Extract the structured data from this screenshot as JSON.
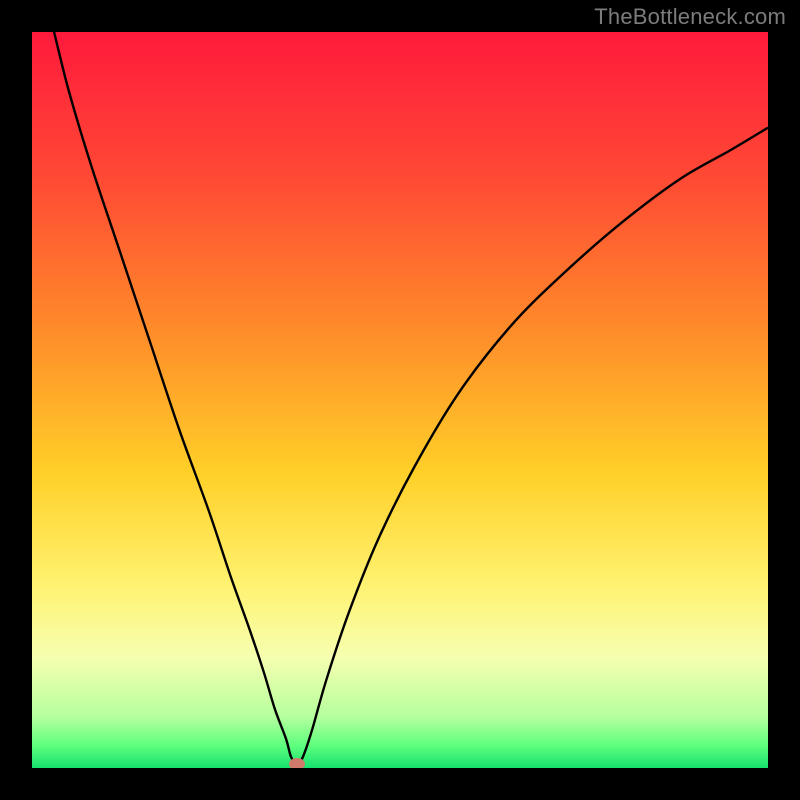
{
  "watermark": "TheBottleneck.com",
  "chart_data": {
    "type": "line",
    "title": "",
    "xlabel": "",
    "ylabel": "",
    "xlim": [
      0,
      100
    ],
    "ylim": [
      0,
      100
    ],
    "gradient_stops": [
      {
        "pos": 0,
        "color": "#ff1a3c"
      },
      {
        "pos": 20,
        "color": "#ff4a34"
      },
      {
        "pos": 40,
        "color": "#ff8a2a"
      },
      {
        "pos": 60,
        "color": "#ffd028"
      },
      {
        "pos": 75,
        "color": "#fff270"
      },
      {
        "pos": 85,
        "color": "#f6ffb0"
      },
      {
        "pos": 93,
        "color": "#b6ff9e"
      },
      {
        "pos": 97,
        "color": "#5eff7e"
      },
      {
        "pos": 100,
        "color": "#18e06e"
      }
    ],
    "series": [
      {
        "name": "bottleneck-curve",
        "x": [
          3,
          5,
          8,
          12,
          16,
          20,
          24,
          27,
          29.5,
          31.5,
          33,
          34.5,
          35.2,
          36,
          36.8,
          38,
          40,
          43,
          47,
          52,
          58,
          65,
          72,
          80,
          88,
          95,
          100
        ],
        "values": [
          100,
          92,
          82,
          70,
          58,
          46,
          35,
          26,
          19,
          13,
          8,
          4,
          1.5,
          0.5,
          1.5,
          5,
          12,
          21,
          31,
          41,
          51,
          60,
          67,
          74,
          80,
          84,
          87
        ]
      }
    ],
    "min_marker": {
      "x": 36,
      "y": 0.5,
      "color": "#cf7a6b"
    }
  }
}
